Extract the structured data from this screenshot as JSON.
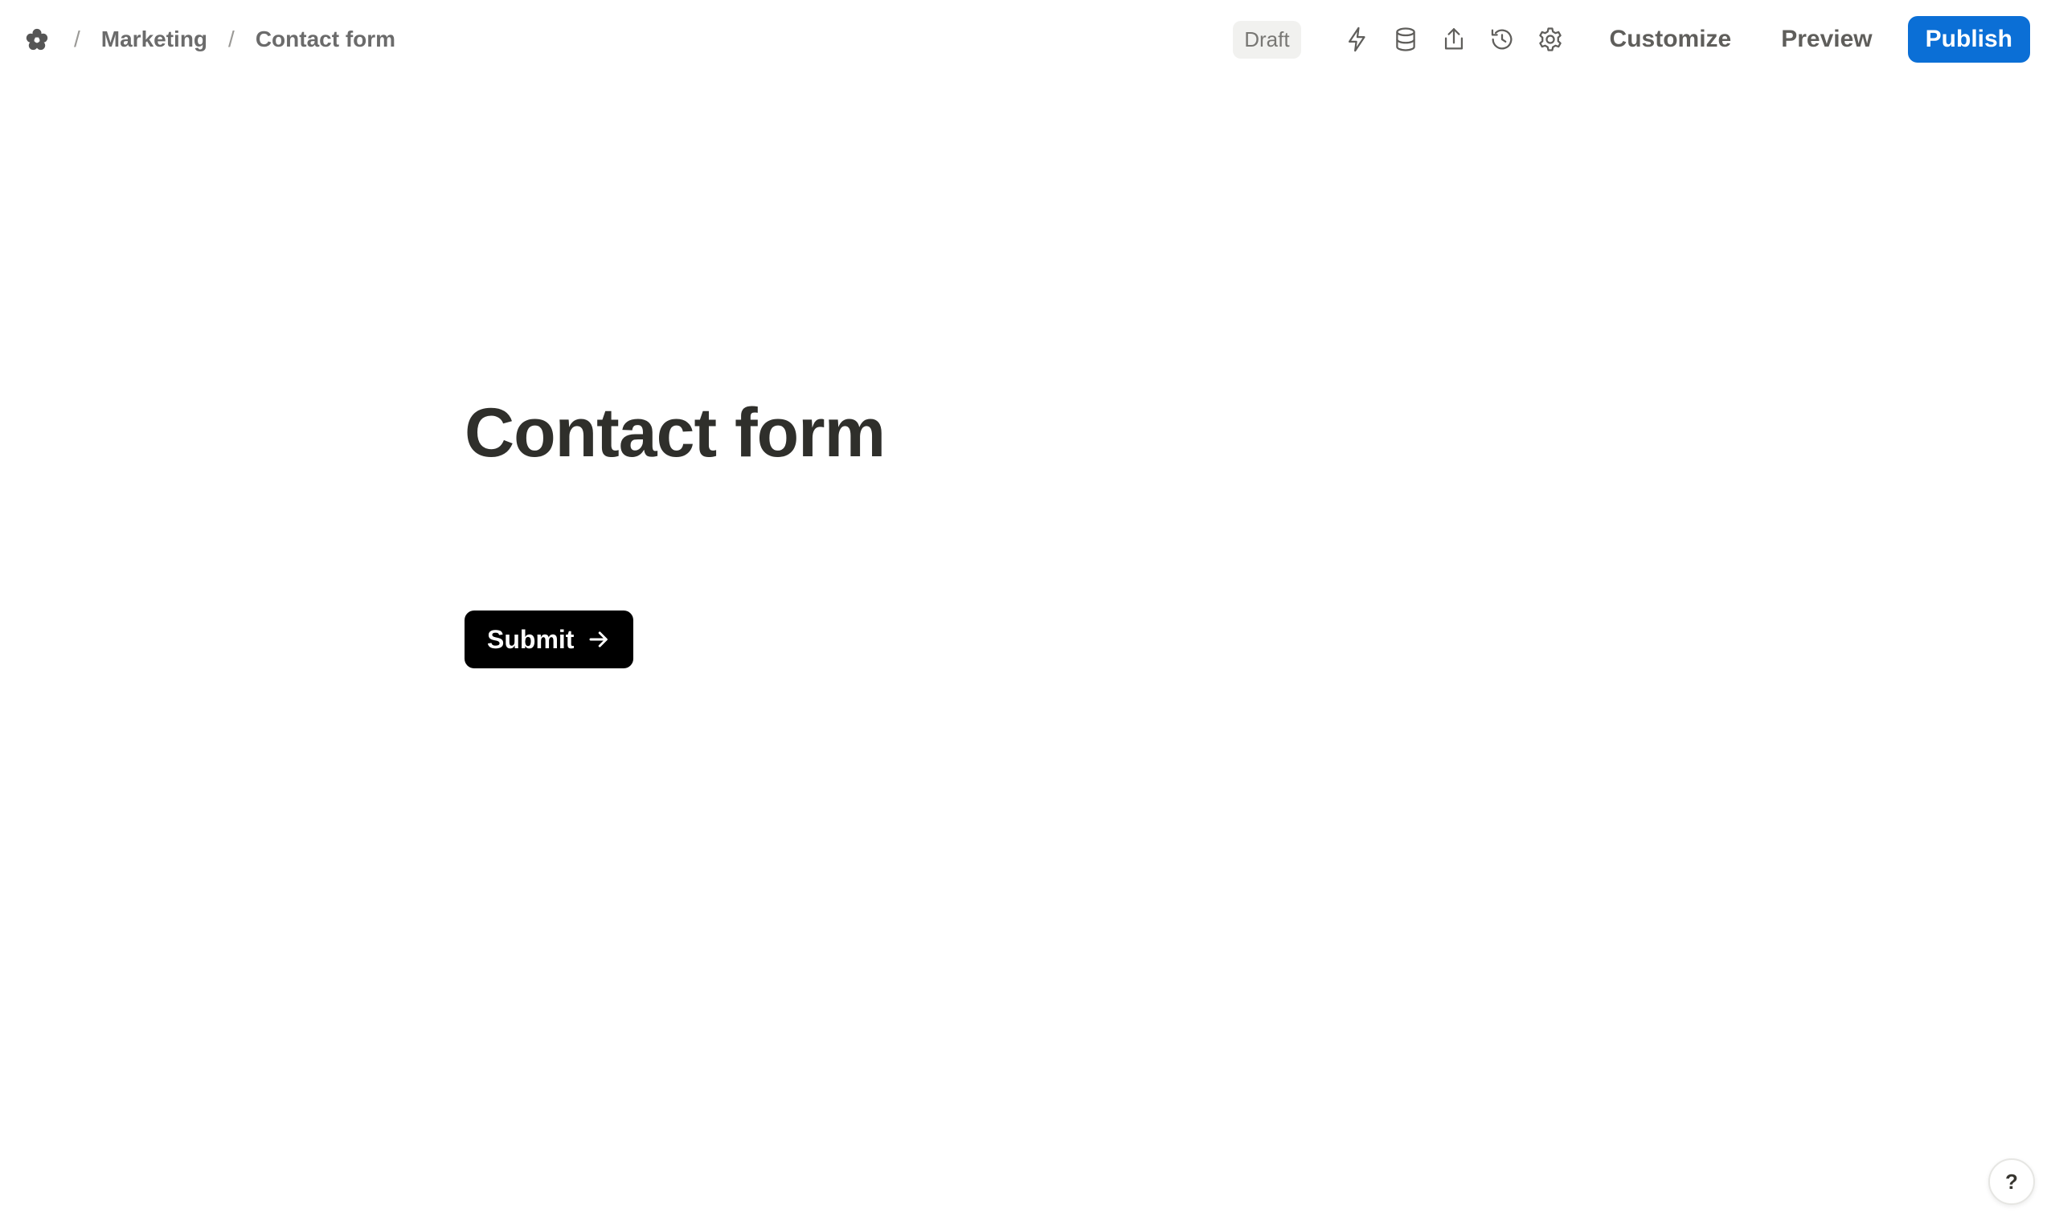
{
  "breadcrumb": {
    "separator": "/",
    "items": [
      "Marketing",
      "Contact form"
    ]
  },
  "header": {
    "status_badge": "Draft",
    "icons": [
      "lightning-icon",
      "database-icon",
      "share-icon",
      "history-icon",
      "gear-icon"
    ],
    "customize_label": "Customize",
    "preview_label": "Preview",
    "publish_label": "Publish"
  },
  "form": {
    "title": "Contact form",
    "submit_label": "Submit"
  },
  "help": {
    "label": "?"
  },
  "colors": {
    "publish": "#0b6fd6",
    "submit": "#000000",
    "title": "#2f2f2b"
  }
}
